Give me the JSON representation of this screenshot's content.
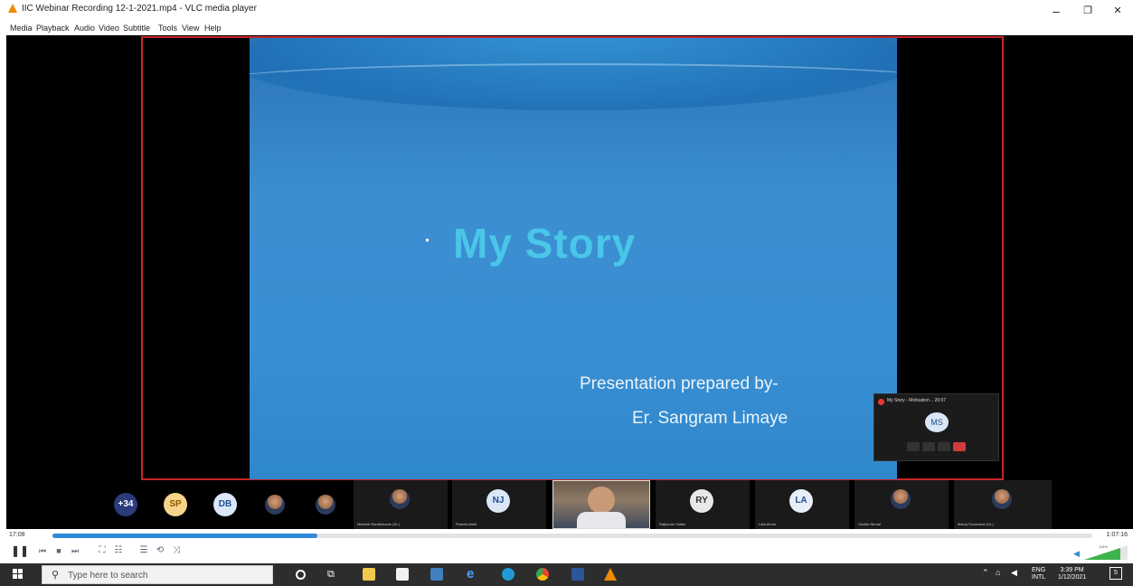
{
  "window": {
    "title": "IIC Webinar Recording 12-1-2021.mp4 - VLC media player",
    "min_glyph": "–",
    "max_glyph": "❐",
    "close_glyph": "✕"
  },
  "menu": [
    "Media",
    "Playback",
    "Audio",
    "Video",
    "Subtitle",
    "Tools",
    "View",
    "Help"
  ],
  "slide": {
    "heading": "My  Story",
    "byline_1": "Presentation prepared by-",
    "byline_2": "Er. Sangram Limaye"
  },
  "meeting_widget": {
    "title": "My Story - Motivation...  20:07",
    "avatar_initials": "MS"
  },
  "participants": [
    {
      "kind": "count",
      "label": "+34",
      "bg": "#2a3a7a",
      "fg": "#ffffff"
    },
    {
      "kind": "initials",
      "label": "SP",
      "bg": "#f6d48b",
      "fg": "#8a5a00"
    },
    {
      "kind": "initials",
      "label": "DB",
      "bg": "#dbe6f7",
      "fg": "#1f4f8f"
    },
    {
      "kind": "photo",
      "label": ""
    },
    {
      "kind": "photo",
      "label": ""
    },
    {
      "kind": "photo-tile",
      "label": "Mahesh Randhavane (Dr.)"
    },
    {
      "kind": "initials-tile",
      "label": "Pamela Ashit",
      "initials": "NJ",
      "bg": "#dbe6f7",
      "fg": "#1f4f8f"
    },
    {
      "kind": "video-tile",
      "label": ""
    },
    {
      "kind": "initials-tile",
      "label": "Rajkumar Yadav",
      "initials": "RY",
      "bg": "#e8e8e8",
      "fg": "#333333"
    },
    {
      "kind": "initials-tile",
      "label": "Lata Ahure",
      "initials": "LA",
      "bg": "#e8eef8",
      "fg": "#1f4f8f"
    },
    {
      "kind": "photo-tile",
      "label": "Sachin Nirmal"
    },
    {
      "kind": "photo-tile",
      "label": "Manoj Sonawane (Dr.)"
    }
  ],
  "player": {
    "elapsed": "17:08",
    "total": "1:07:16",
    "progress_fraction": 0.255,
    "volume_label": "115%"
  },
  "taskbar": {
    "search_placeholder": "Type here to search",
    "lang_1": "ENG",
    "lang_2": "INTL",
    "time": "3:39 PM",
    "date": "1/12/2021",
    "notification_count": "5"
  },
  "colors": {
    "accent_red": "#c8262b",
    "seek_fill": "#2f8ad8",
    "heading_cyan": "#49c6e8"
  }
}
